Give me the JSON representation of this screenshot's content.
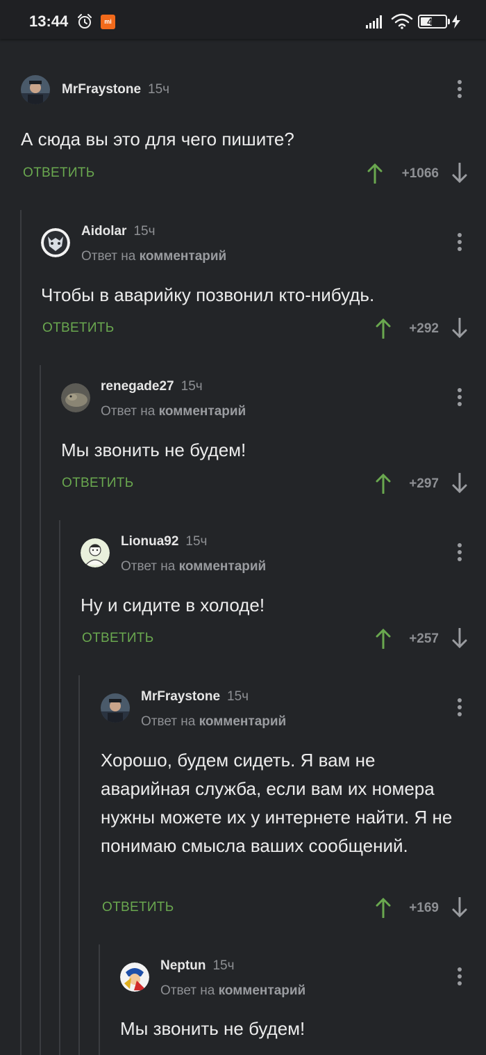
{
  "status_bar": {
    "time": "13:44",
    "battery": "46",
    "battery_level": 0.46,
    "icons": [
      "alarm-icon",
      "mi-icon",
      "signal-icon",
      "wifi-icon",
      "battery-icon",
      "charging-bolt-icon"
    ]
  },
  "colors": {
    "background": "#232528",
    "reply_green": "#6aa84f",
    "upvote_green": "#6aa84f",
    "muted": "#8e9094",
    "thread_line": "#3a3c40"
  },
  "labels": {
    "reply": "ОТВЕТИТЬ",
    "reply_to_prefix": "Ответ на",
    "reply_to_link": "комментарий"
  },
  "comments": [
    {
      "user": "MrFraystone",
      "time": "15ч",
      "text": "А сюда вы это для чего пишите?",
      "score": "+1066",
      "is_reply": false
    },
    {
      "user": "Aidolar",
      "time": "15ч",
      "text": "Чтобы в аварийку позвонил кто-нибудь.",
      "score": "+292",
      "is_reply": true
    },
    {
      "user": "renegade27",
      "time": "15ч",
      "text": "Мы звонить не будем!",
      "score": "+297",
      "is_reply": true
    },
    {
      "user": "Lionua92",
      "time": "15ч",
      "text": "Ну и сидите в холоде!",
      "score": "+257",
      "is_reply": true
    },
    {
      "user": "MrFraystone",
      "time": "15ч",
      "text": "Хорошо, будем сидеть. Я вам не аварийная служба, если вам их номера нужны можете их у интернете найти. Я не понимаю смысла ваших сообщений.",
      "score": "+169",
      "is_reply": true
    },
    {
      "user": "Neptun",
      "time": "15ч",
      "text": "Мы звонить не будем!",
      "score": "",
      "is_reply": true
    }
  ]
}
